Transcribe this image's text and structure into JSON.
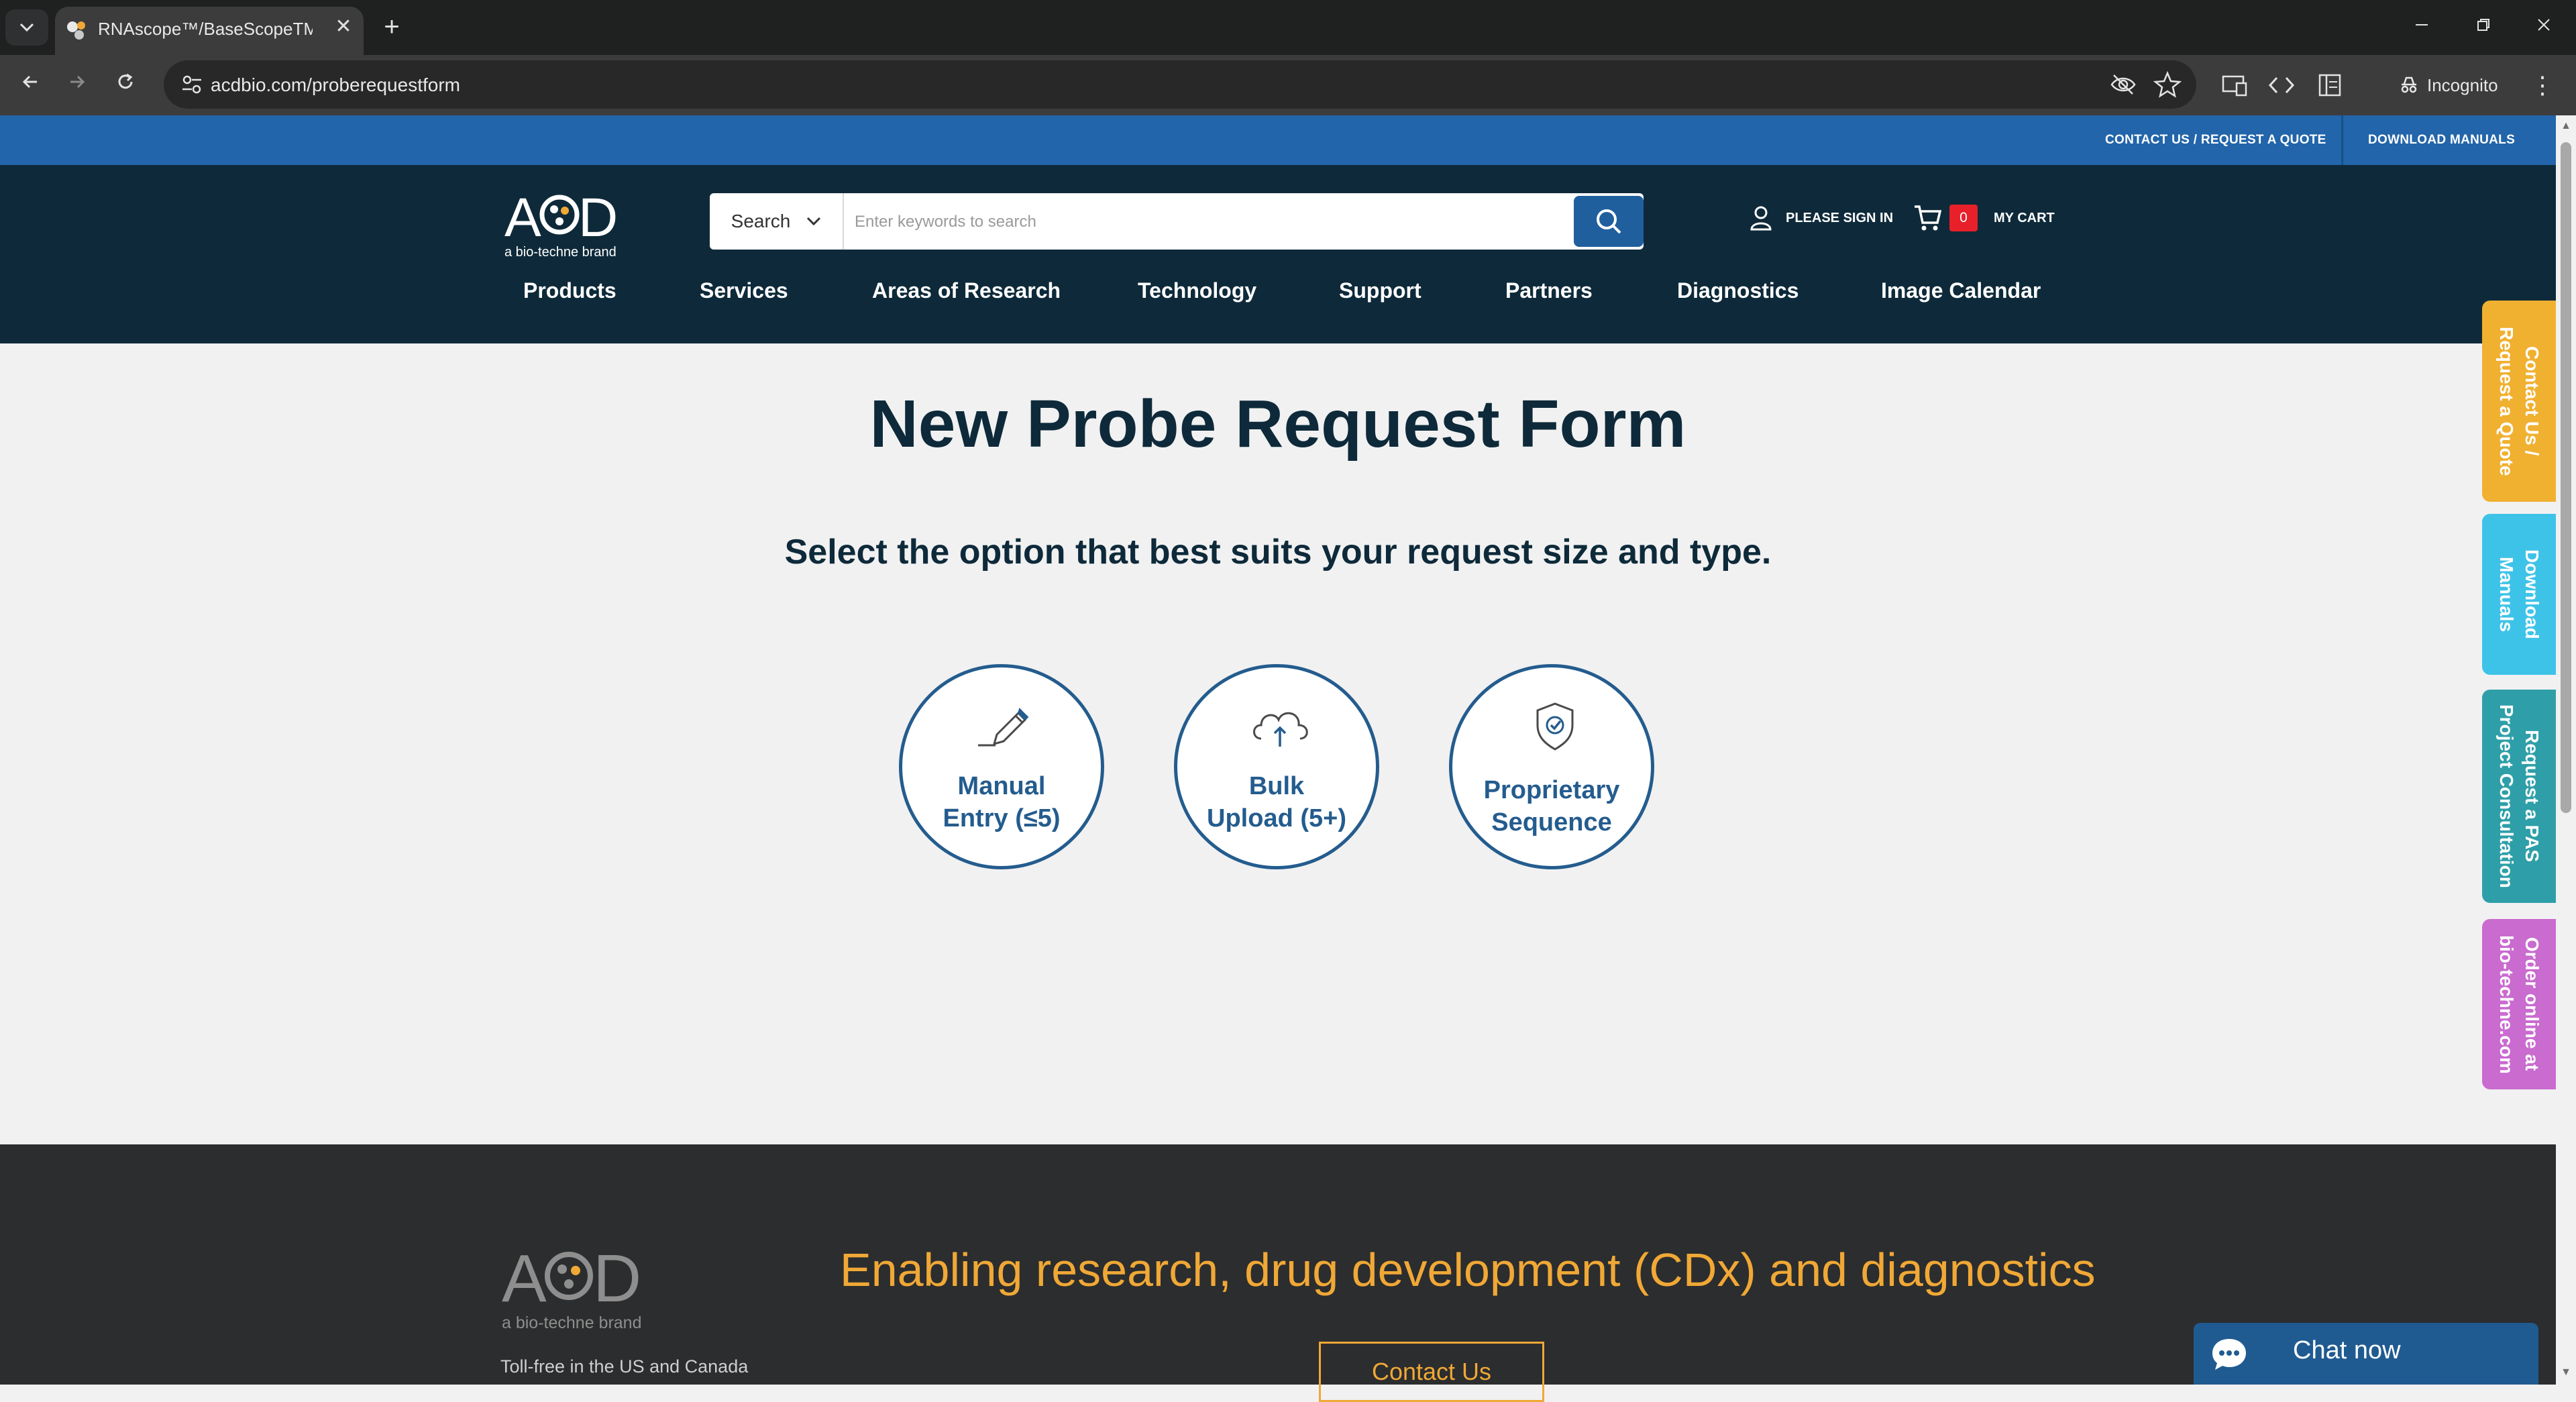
{
  "browser": {
    "tab_title": "RNAscope™/BaseScopeTM/miR",
    "tab_close": "✕",
    "new_tab": "+",
    "url": "acdbio.com/proberequestform",
    "incognito_label": "Incognito"
  },
  "top_strip": {
    "contact_label": "CONTACT US / REQUEST A QUOTE",
    "manuals_label": "DOWNLOAD MANUALS"
  },
  "header": {
    "logo_alt": "ACD a bio-techne brand",
    "search_category": "Search",
    "search_placeholder": "Enter keywords to search",
    "signin_label": "PLEASE SIGN IN",
    "cart_count": "0",
    "cart_label": "MY CART",
    "nav": [
      "Products",
      "Services",
      "Areas of Research",
      "Technology",
      "Support",
      "Partners",
      "Diagnostics",
      "Image Calendar"
    ]
  },
  "main": {
    "title": "New Probe Request Form",
    "subtitle": "Select the option that best suits your request size and type.",
    "options": [
      {
        "line1": "Manual",
        "line2": "Entry (≤5)",
        "icon": "pencil-icon"
      },
      {
        "line1": "Bulk",
        "line2": "Upload (5+)",
        "icon": "cloud-upload-icon"
      },
      {
        "line1": "Proprietary",
        "line2": "Sequence",
        "icon": "shield-check-icon"
      }
    ]
  },
  "footer": {
    "tagline": "Enabling research, drug development (CDx) and diagnostics",
    "toll_free": "Toll-free in the US and Canada",
    "contact_button": "Contact Us"
  },
  "side_tabs": [
    {
      "label": "Contact Us /\nRequest a Quote",
      "color": "#f0b030"
    },
    {
      "label": "Download\nManuals",
      "color": "#3ec3e8"
    },
    {
      "label": "Request a PAS\nProject Consultation",
      "color": "#2e9fa8"
    },
    {
      "label": "Order online at\nbio-techne.com",
      "color": "#c96bcf"
    }
  ],
  "chat": {
    "label": "Chat now"
  },
  "colors": {
    "brand_blue": "#2265aa",
    "header_navy": "#0e2a3a",
    "accent_orange": "#f0a836",
    "cart_badge": "#e8202a"
  }
}
